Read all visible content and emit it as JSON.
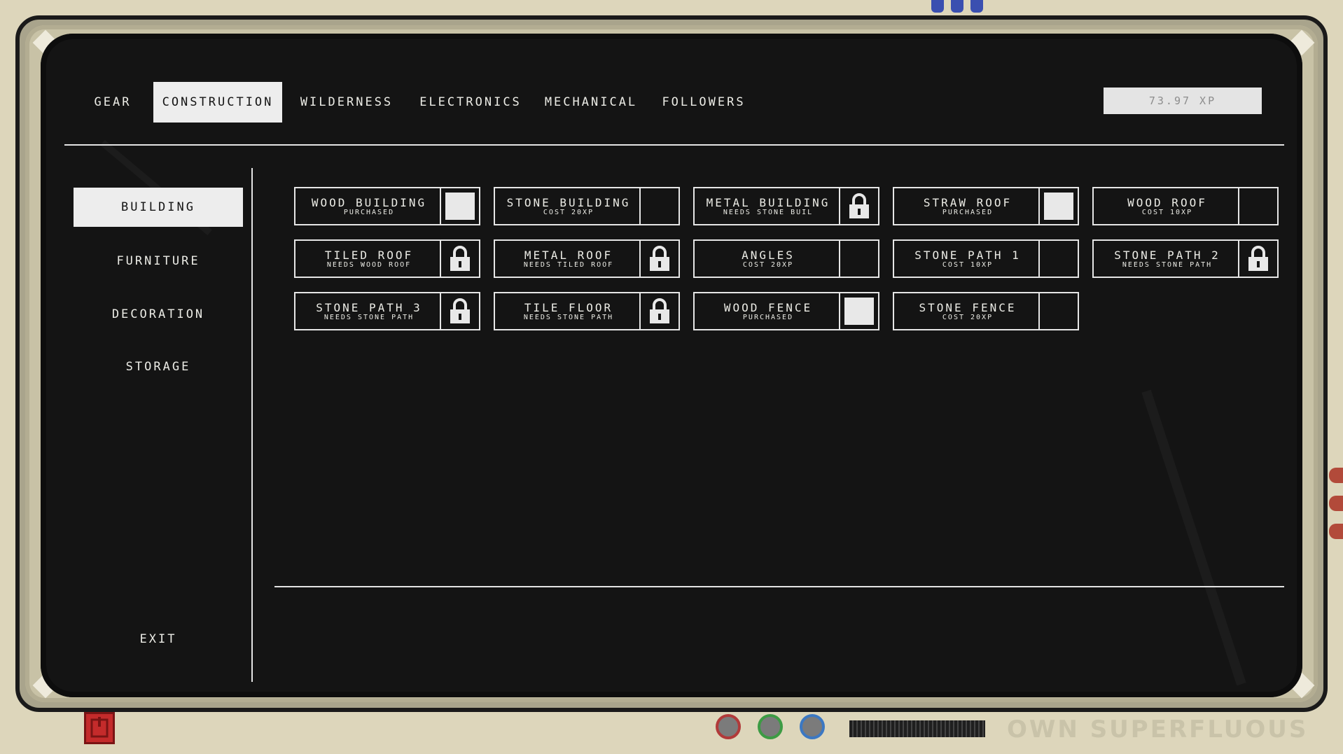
{
  "top_tabs": [
    {
      "label": "GEAR",
      "active": false
    },
    {
      "label": "CONSTRUCTION",
      "active": true
    },
    {
      "label": "WILDERNESS",
      "active": false
    },
    {
      "label": "ELECTRONICS",
      "active": false
    },
    {
      "label": "MECHANICAL",
      "active": false
    },
    {
      "label": "FOLLOWERS",
      "active": false
    }
  ],
  "xp": {
    "value": "73.97 XP"
  },
  "sidebar": {
    "items": [
      {
        "label": "BUILDING",
        "active": true
      },
      {
        "label": "FURNITURE",
        "active": false
      },
      {
        "label": "DECORATION",
        "active": false
      },
      {
        "label": "STORAGE",
        "active": false
      }
    ],
    "exit_label": "EXIT"
  },
  "recipes": [
    {
      "name": "WOOD BUILDING",
      "sub": "PURCHASED",
      "status": "purchased"
    },
    {
      "name": "STONE BUILDING",
      "sub": "COST 20XP",
      "status": "available"
    },
    {
      "name": "METAL BUILDING",
      "sub": "NEEDS STONE BUIL",
      "status": "locked"
    },
    {
      "name": "STRAW ROOF",
      "sub": "PURCHASED",
      "status": "purchased"
    },
    {
      "name": "WOOD ROOF",
      "sub": "COST 10XP",
      "status": "available"
    },
    {
      "name": "TILED ROOF",
      "sub": "NEEDS WOOD ROOF",
      "status": "locked"
    },
    {
      "name": "METAL ROOF",
      "sub": "NEEDS TILED ROOF",
      "status": "locked"
    },
    {
      "name": "ANGLES",
      "sub": "COST 20XP",
      "status": "available"
    },
    {
      "name": "STONE PATH 1",
      "sub": "COST 10XP",
      "status": "available"
    },
    {
      "name": "STONE PATH 2",
      "sub": "NEEDS STONE PATH",
      "status": "locked"
    },
    {
      "name": "STONE PATH 3",
      "sub": "NEEDS STONE PATH",
      "status": "locked"
    },
    {
      "name": "TILE FLOOR",
      "sub": "NEEDS STONE PATH",
      "status": "locked"
    },
    {
      "name": "WOOD FENCE",
      "sub": "PURCHASED",
      "status": "purchased"
    },
    {
      "name": "STONE FENCE",
      "sub": "COST 20XP",
      "status": "available"
    }
  ],
  "brand": {
    "text": "OWN SUPERFLUOUS"
  },
  "icons": {
    "power": "power-icon",
    "lock": "lock-icon",
    "check": "purchased-check-icon"
  },
  "colors": {
    "screen_bg": "#141414",
    "text": "#ecece6",
    "active_bg": "#ededed",
    "bezel": "#ddd6bb",
    "power": "#c42b2b"
  }
}
